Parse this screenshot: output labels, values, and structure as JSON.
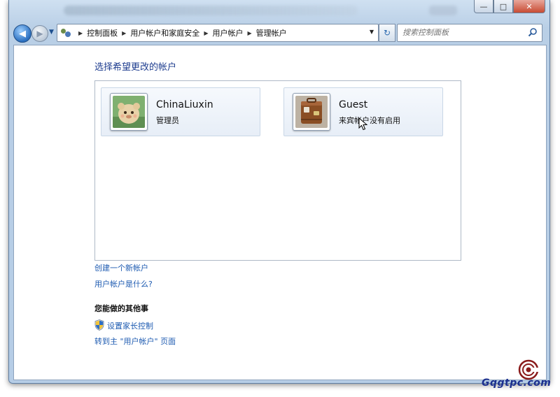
{
  "window": {
    "caption_buttons": [
      "minimize",
      "maximize",
      "close"
    ]
  },
  "nav": {
    "breadcrumbs": [
      "控制面板",
      "用户帐户和家庭安全",
      "用户帐户",
      "管理帐户"
    ],
    "search_placeholder": "搜索控制面板"
  },
  "main": {
    "title": "选择希望更改的帐户",
    "accounts": [
      {
        "name": "ChinaLiuxin",
        "description": "管理员",
        "icon": "avatar-icon"
      },
      {
        "name": "Guest",
        "description": "来宾帐户没有启用",
        "icon": "suitcase-icon"
      }
    ],
    "links": {
      "create_account": "创建一个新帐户",
      "what_is_account": "用户帐户是什么?"
    },
    "other_section": {
      "heading": "您能做的其他事",
      "parental_controls": "设置家长控制",
      "go_to_main": "转到主 \"用户帐户\" 页面"
    }
  },
  "watermark": "Gqgtpc.com",
  "colors": {
    "link": "#1e5bb1",
    "title": "#1e3d8f",
    "frame": "#b9cfe6"
  }
}
